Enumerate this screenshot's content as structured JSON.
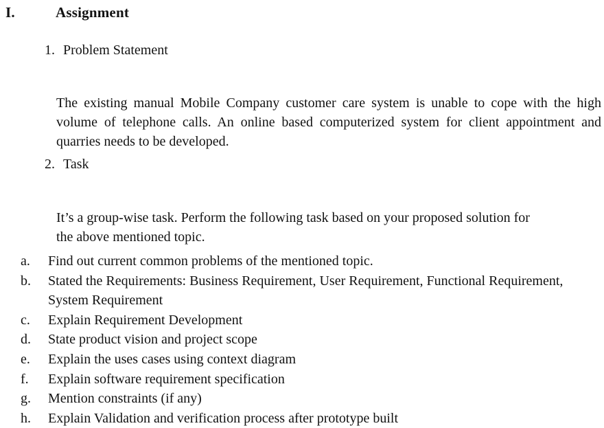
{
  "document": {
    "heading": {
      "marker": "I.",
      "title": "Assignment"
    },
    "sections": [
      {
        "marker": "1.",
        "label": "Problem Statement",
        "paragraph": "The existing manual Mobile Company customer care system is unable to cope with the high volume of telephone calls. An online based computerized system for client appointment and quarries needs to be developed."
      },
      {
        "marker": "2.",
        "label": "Task",
        "paragraph": "It’s a group-wise task. Perform the following task based on your proposed solution for the above mentioned topic."
      }
    ],
    "task_list": [
      {
        "marker": "a.",
        "text": "Find out current common problems of the mentioned topic."
      },
      {
        "marker": "b.",
        "text": "Stated the Requirements: Business Requirement, User Requirement, Functional Requirement, System Requirement"
      },
      {
        "marker": "c.",
        "text": "Explain Requirement Development"
      },
      {
        "marker": "d.",
        "text": "State product vision and project scope"
      },
      {
        "marker": "e.",
        "text": "Explain the uses cases using context  diagram"
      },
      {
        "marker": "f.",
        "text": "Explain software requirement specification"
      },
      {
        "marker": "g.",
        "text": "Mention constraints (if any)"
      },
      {
        "marker": "h.",
        "text": "Explain Validation and verification process after prototype built"
      }
    ],
    "colors": {
      "page_background": "#ffffff",
      "text": "#121212"
    }
  }
}
